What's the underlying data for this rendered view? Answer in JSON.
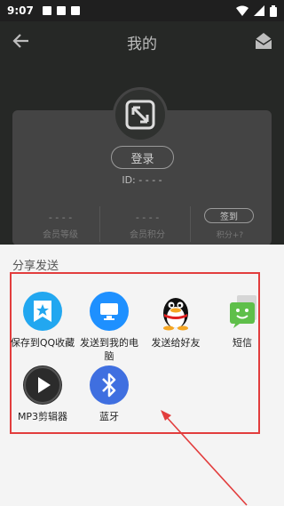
{
  "status_bar": {
    "time": "9:07"
  },
  "app_bar": {
    "title": "我的"
  },
  "profile": {
    "login_label": "登录",
    "id_text": "ID: - - - -",
    "stats": [
      {
        "value": "- - - -",
        "label": "会员等级"
      },
      {
        "value": "- - - -",
        "label": "会员积分"
      }
    ],
    "signin_label": "签到",
    "signin_sub": "积分+?"
  },
  "share": {
    "title": "分享发送",
    "items": [
      {
        "label": "保存到QQ收藏",
        "icon": "qq-favorite-icon"
      },
      {
        "label": "发送到我的电脑",
        "icon": "my-computer-icon"
      },
      {
        "label": "发送给好友",
        "icon": "qq-penguin-icon"
      },
      {
        "label": "短信",
        "icon": "sms-icon"
      },
      {
        "label": "MP3剪辑器",
        "icon": "mp3-editor-icon"
      },
      {
        "label": "蓝牙",
        "icon": "bluetooth-icon"
      }
    ]
  },
  "colors": {
    "highlight_box": "#e23d3d",
    "dim_background": "#262826"
  }
}
